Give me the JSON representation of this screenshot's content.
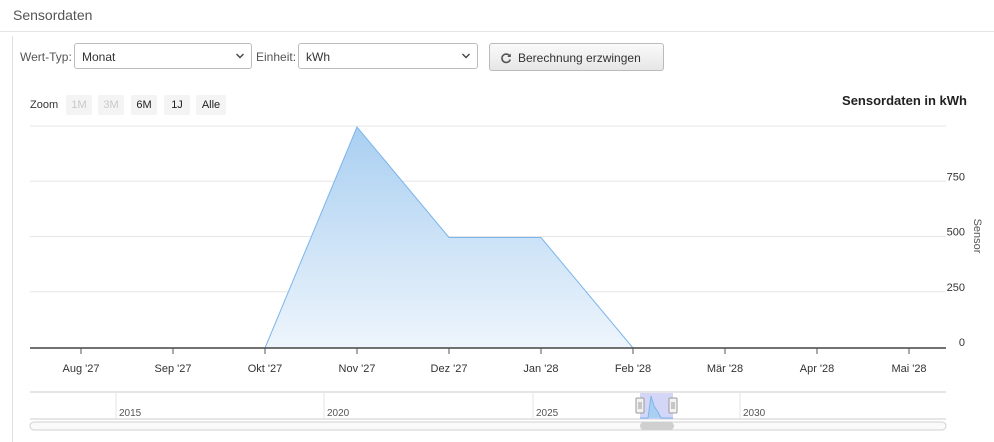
{
  "page": {
    "title": "Sensordaten"
  },
  "controls": {
    "value_type_label": "Wert-Typ:",
    "value_type_selected": "Monat",
    "unit_label": "Einheit:",
    "unit_selected": "kWh",
    "force_button_label": "Berechnung erzwingen"
  },
  "zoom": {
    "label": "Zoom",
    "buttons": [
      {
        "label": "1M",
        "enabled": false
      },
      {
        "label": "3M",
        "enabled": false
      },
      {
        "label": "6M",
        "enabled": true
      },
      {
        "label": "1J",
        "enabled": true
      },
      {
        "label": "Alle",
        "enabled": true
      }
    ]
  },
  "chart_data": {
    "type": "area",
    "title": "Sensordaten in kWh",
    "ylabel": "Sensor",
    "xlabel": "",
    "x_ticks": [
      "Aug '27",
      "Sep '27",
      "Okt '27",
      "Nov '27",
      "Dez '27",
      "Jan '28",
      "Feb '28",
      "Mär '28",
      "Apr '28",
      "Mai '28"
    ],
    "y_ticks": [
      0,
      250,
      500,
      750
    ],
    "ylim": [
      0,
      1000
    ],
    "series": [
      {
        "x": [
          "2027-07",
          "2027-08",
          "2027-09",
          "2027-10",
          "2027-11",
          "2027-12",
          "2028-01",
          "2028-02",
          "2028-03",
          "2028-04",
          "2028-05"
        ],
        "y": [
          0,
          0,
          0,
          0,
          1000,
          500,
          500,
          0,
          0,
          0,
          0
        ]
      }
    ],
    "grid": true,
    "y_axis_side": "right",
    "navigator_labels": [
      "2015",
      "2020",
      "2025",
      "2030"
    ]
  },
  "colors": {
    "line": "#7cb5ec",
    "fill_top": "#a9cff1",
    "fill_bottom": "#eef5fc",
    "grid": "#e6e6e6",
    "navigator_mask": "#c6c8f5"
  }
}
